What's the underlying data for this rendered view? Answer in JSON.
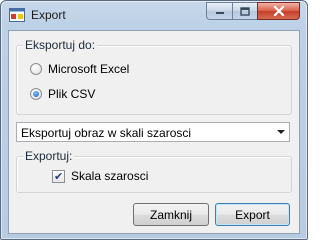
{
  "window": {
    "title": "Export"
  },
  "export_to": {
    "label": "Eksportuj do:",
    "options": [
      {
        "label": "Microsoft Excel",
        "selected": false
      },
      {
        "label": "Plik CSV",
        "selected": true
      }
    ]
  },
  "dropdown": {
    "selected": "Eksportuj obraz w skali szarosci"
  },
  "export": {
    "label": "Exportuj:",
    "checkbox": {
      "label": "Skala szarosci",
      "checked": true
    }
  },
  "buttons": {
    "close_label": "Zamknij",
    "export_label": "Export"
  },
  "colors": {
    "accent": "#1b5fb8",
    "close_button": "#c4402a"
  }
}
